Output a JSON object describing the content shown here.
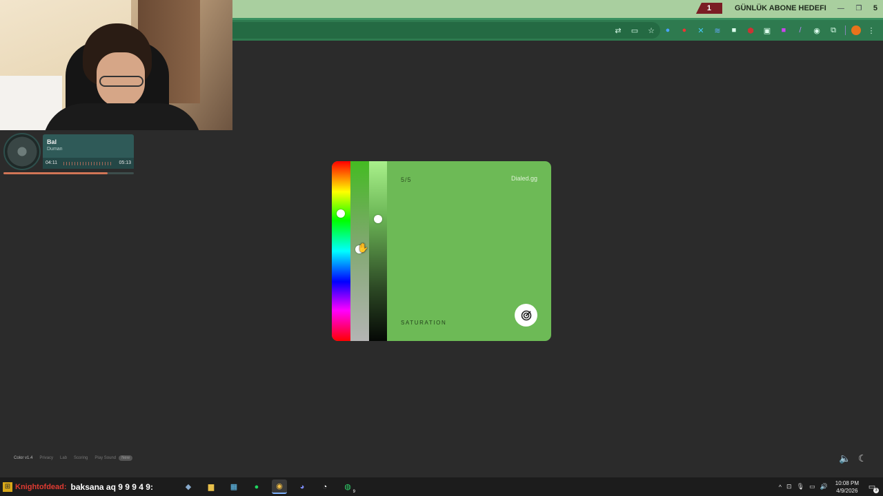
{
  "stream": {
    "goal": {
      "count": "1",
      "label": "GÜNLÜK ABONE HEDEFI",
      "target": "5"
    }
  },
  "music": {
    "title": "Bal",
    "artist": "Duman",
    "elapsed": "04:11",
    "total": "05:13",
    "progress_fraction": 0.8
  },
  "picker": {
    "counter": "5/5",
    "brand": "Dialed.gg",
    "mode": "SATURATION",
    "current_color": "#6dba56",
    "hue_level": 0.29,
    "saturation_level": 0.49,
    "lightness_level": 0.32
  },
  "footer": {
    "version": "Color v1.4",
    "links": [
      "Privacy",
      "Lab",
      "Scoring",
      "Play Sound"
    ],
    "badge": "New"
  },
  "taskbar": {
    "ticker_red": "Knightofdead:",
    "ticker_text": "baksana aq 9 9 9 4 9:",
    "whatsapp_badge": "9",
    "time": "10:08 PM",
    "date": "4/9/2026",
    "notification_count": "3"
  },
  "colors": {
    "accent": "#6dba56",
    "page_bg": "#2b2b2b",
    "toolbar": "#2e7a4f",
    "tabbar": "#a9cf9f"
  }
}
